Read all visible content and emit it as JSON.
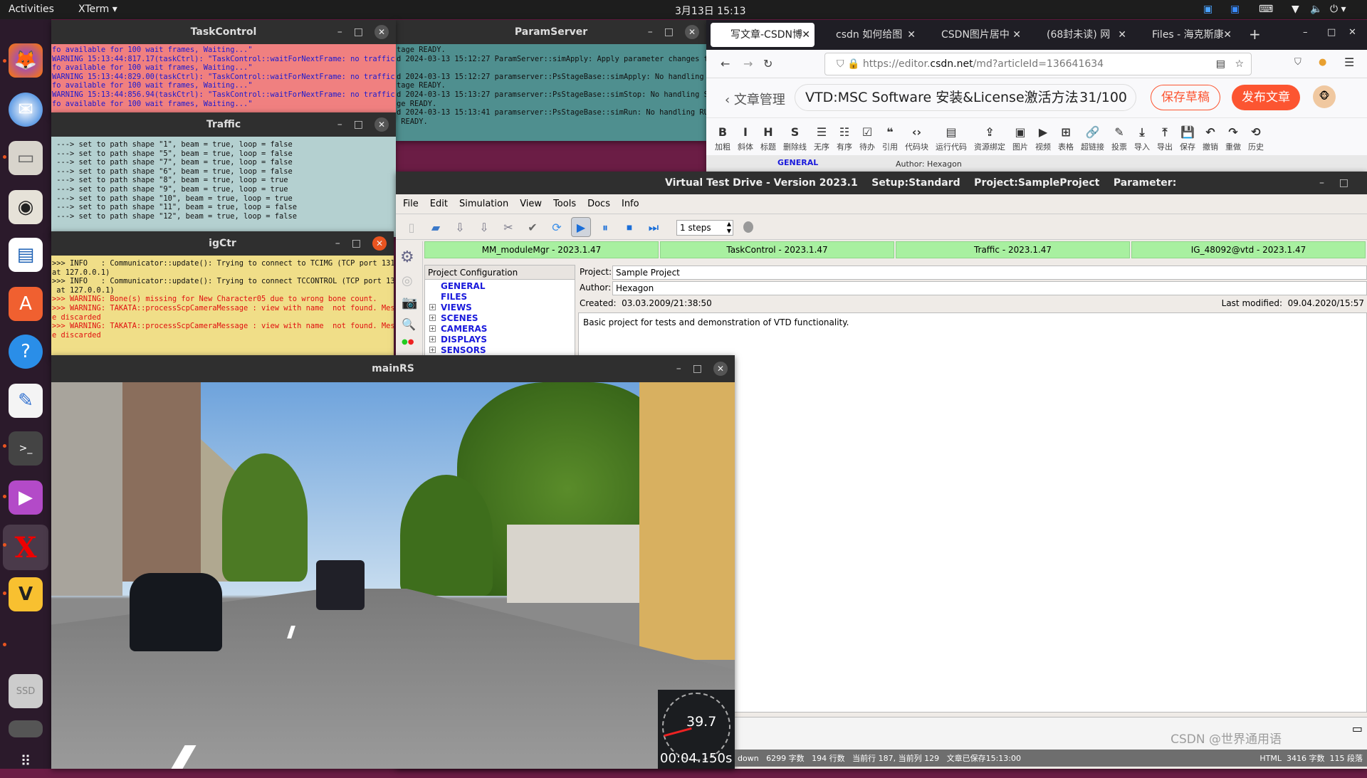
{
  "topbar": {
    "activities": "Activities",
    "app": "XTerm ▾",
    "clock": "3月13日  15:13"
  },
  "dock": [
    "firefox-icon",
    "thunderbird-icon",
    "files-icon",
    "rhythmbox-icon",
    "writer-icon",
    "app-center-icon",
    "help-icon",
    "text-editor-icon",
    "terminal-icon",
    "video-icon",
    "xterm-icon",
    "vim-icon",
    "ssd-icon",
    "drive-icon",
    "apps-grid-icon"
  ],
  "taskcontrol": {
    "title": "TaskControl",
    "bg": "#f08080",
    "lines": [
      "fo available for 100 wait frames, Waiting...\"",
      "WARNING 15:13:44:817.17(taskCtrl): \"TaskControl::waitForNextFrame: no traffic in",
      "fo available for 100 wait frames, Waiting...\"",
      "WARNING 15:13:44:829.00(taskCtrl): \"TaskControl::waitForNextFrame: no traffic in",
      "fo available for 100 wait frames, Waiting...\"",
      "WARNING 15:13:44:856.94(taskCtrl): \"TaskControl::waitForNextFrame: no traffic in",
      "fo available for 100 wait frames, Waiting...\""
    ]
  },
  "paramserver": {
    "title": "ParamServer",
    "bg": "#4f8f8f",
    "lines": [
      "tage READY.",
      "d 2024-03-13 15:12:27 ParamServer::simApply: Apply parameter changes to",
      "",
      "d 2024-03-13 15:12:27 paramserver::PsStageBase::simApply: No handling AP",
      "tage READY.",
      "d 2024-03-13 15:13:27 paramserver::PsStageBase::simStop: No handling STO",
      "ge READY.",
      "d 2024-03-13 15:13:41 paramserver::PsStageBase::simRun: No handling RUN",
      " READY."
    ]
  },
  "traffic": {
    "title": "Traffic",
    "bg": "#b4d0d0",
    "lines": [
      " ---> set to path shape \"1\", beam = true, loop = false",
      " ---> set to path shape \"5\", beam = true, loop = false",
      " ---> set to path shape \"7\", beam = true, loop = false",
      " ---> set to path shape \"6\", beam = true, loop = false",
      " ---> set to path shape \"8\", beam = true, loop = true",
      " ---> set to path shape \"9\", beam = true, loop = true",
      " ---> set to path shape \"10\", beam = true, loop = true",
      " ---> set to path shape \"11\", beam = true, loop = false",
      " ---> set to path shape \"12\", beam = true, loop = false"
    ]
  },
  "igctr": {
    "title": "igCtr",
    "bg": "#f0de88",
    "lines": [
      ">>> INFO   : Communicator::update(): Trying to connect to TCIMG (TCP port 13110",
      "at 127.0.0.1)",
      ">>> INFO   : Communicator::update(): Trying to connect TCCONTROL (TCP port 13112",
      " at 127.0.0.1)",
      ">>> WARNING: Bone(s) missing for New Character05 due to wrong bone count.",
      ">>> WARNING: TAKATA::processScpCameraMessage : view with name  not found. Messag",
      "e discarded",
      ">>> WARNING: TAKATA::processScpCameraMessage : view with name  not found. Messag",
      "e discarded"
    ],
    "warn_from": 4
  },
  "mainrs": {
    "title": "mainRS",
    "speed": "39.7",
    "time": "00:04.150s"
  },
  "browser": {
    "tabs": [
      "写文章-CSDN博",
      "csdn 如何给图",
      "CSDN图片居中",
      "(68封未读) 网",
      "Files - 海克斯康"
    ],
    "url_pre": "https://editor.",
    "url_host": "csdn.net",
    "url_post": "/md?articleId=136641634",
    "back": "文章管理",
    "article_title": "VTD:MSC Software 安装&License激活方法",
    "count": "31/100",
    "save_draft": "保存草稿",
    "publish": "发布文章",
    "tools": [
      [
        "B",
        "加粗"
      ],
      [
        "I",
        "斜体"
      ],
      [
        "H",
        "标题"
      ],
      [
        "S",
        "删除线"
      ],
      [
        "☰",
        "无序"
      ],
      [
        "☷",
        "有序"
      ],
      [
        "☑",
        "待办"
      ],
      [
        "❝",
        "引用"
      ],
      [
        "‹›",
        "代码块"
      ],
      [
        "▤",
        "运行代码"
      ],
      [
        "⇪",
        "资源绑定"
      ],
      [
        "▣",
        "图片"
      ],
      [
        "▶",
        "视频"
      ],
      [
        "⊞",
        "表格"
      ],
      [
        "🔗",
        "超链接"
      ],
      [
        "✎",
        "投票"
      ],
      [
        "⤓",
        "导入"
      ],
      [
        "⤒",
        "导出"
      ],
      [
        "💾",
        "保存"
      ],
      [
        "↶",
        "撤销"
      ],
      [
        "↷",
        "重做"
      ],
      [
        "⟲",
        "历史"
      ]
    ],
    "preview_general": "GENERAL",
    "preview_author": "Author: Hexagon",
    "status_left": "down   6299 字数   194 行数   当前行 187, 当前列 129   文章已保存15:13:00",
    "status_right": "HTML  3416 字数  115 段落",
    "watermark": "CSDN @世界通用语"
  },
  "vtd": {
    "title": "Virtual Test Drive - Version 2023.1    Setup:Standard    Project:SampleProject    Parameter:",
    "menu": [
      "File",
      "Edit",
      "Simulation",
      "View",
      "Tools",
      "Docs",
      "Info"
    ],
    "steps": "1 steps",
    "modules": [
      "MM_moduleMgr - 2023.1.47",
      "TaskControl - 2023.1.47",
      "Traffic -  2023.1.47",
      "IG_48092@vtd - 2023.1.47"
    ],
    "tree_header": "Project Configuration",
    "tree": [
      "GENERAL",
      "FILES",
      "VIEWS",
      "SCENES",
      "CAMERAS",
      "DISPLAYS",
      "SENSORS"
    ],
    "project_label": "Project:",
    "project": "Sample Project",
    "author_label": "Author:",
    "author": "Hexagon",
    "created": "Created:  03.03.2009/21:38:50",
    "modified": "Last modified:  09.04.2020/15:57",
    "description": "Basic project for tests and demonstration of VTD functionality.",
    "module_color": "#a8f0a0"
  }
}
